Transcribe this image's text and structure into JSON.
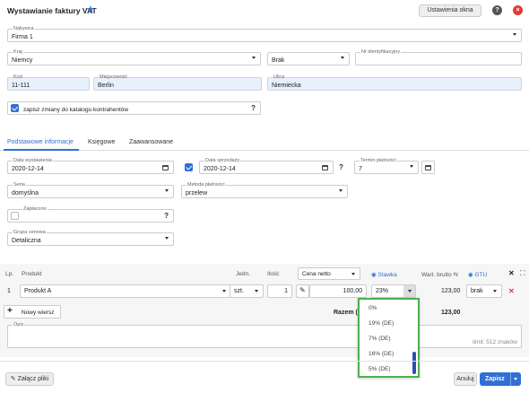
{
  "window": {
    "title": "Wystawianie faktury VAT",
    "settings_btn": "Ustawienia okna"
  },
  "buyer": {
    "nabywca_label": "Nabywca",
    "nabywca": "Firma 1",
    "kraj_label": "Kraj",
    "kraj": "Niemcy",
    "brak": "Brak",
    "nip_label": "Nr identyfikacyjny",
    "nip": "",
    "kod_label": "Kod",
    "kod": "11-111",
    "miasto_label": "Miejscowość",
    "miasto": "Berlin",
    "ulica_label": "Ulica",
    "ulica": "Niemiecka",
    "save_contacts": "zapisz zmiany do katalogu kontrahentów"
  },
  "tabs": [
    "Podstawowe informacje",
    "Księgowe",
    "Zaawansowane"
  ],
  "basic": {
    "data_wyst_label": "Data wystawienia",
    "data_wyst": "2020-12-14",
    "data_sprz_label": "Data sprzedaży",
    "data_sprz": "2020-12-14",
    "termin_label": "Termin płatności",
    "termin": "7",
    "seria_label": "Seria",
    "seria": "domyślna",
    "metoda_label": "Metoda płatności",
    "metoda": "przelew",
    "zaplacono_label": "Zapłacono",
    "grupa_label": "Grupa cenowa",
    "grupa": "Detaliczna"
  },
  "items": {
    "headers": {
      "lp": "Lp.",
      "produkt": "Produkt",
      "jedn": "Jedn.",
      "ilosc": "Ilość",
      "cena": "Cena netto",
      "stawka": "Stawka",
      "wart": "Wart. brutto",
      "gtu": "GTU"
    },
    "row": {
      "lp": "1",
      "produkt": "Produkt A",
      "jedn": "szt.",
      "ilosc": "1",
      "cena": "100,00",
      "stawka": "23%",
      "wart": "123,00",
      "gtu": "brak"
    },
    "add_row": "Nowy wiersz",
    "razem_label": "Razem (P",
    "razem": "123,00"
  },
  "vat_options": [
    "0%",
    "19% (DE)",
    "7% (DE)",
    "16% (DE)",
    "5% (DE)"
  ],
  "opis": {
    "label": "Opis",
    "limit": "limit: 512 znaków"
  },
  "footer": {
    "attach": "Załącz pliki",
    "cancel": "Anuluj",
    "save": "Zapisz"
  },
  "colors": {
    "accent": "#2f6fd6",
    "close": "#e53935",
    "dropdown_border": "#4caf50",
    "tab_active": "#2f6fd6"
  }
}
